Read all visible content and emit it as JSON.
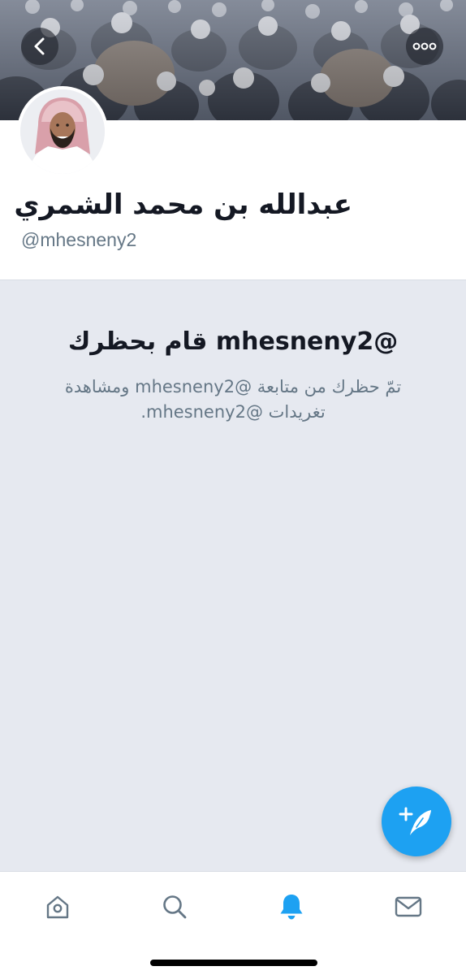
{
  "profile": {
    "display_name": "عبدالله بن محمد الشمري",
    "handle": "@mhesneny2"
  },
  "blocked_notice": {
    "title": "@mhesneny2 قام بحظرك",
    "body": "تمّ حظرك من متابعة @mhesneny2 ومشاهدة تغريدات @mhesneny2."
  },
  "icons": {
    "back": "chevron-left-icon",
    "more": "more-dots-icon",
    "compose": "compose-tweet-icon",
    "home": "home-icon",
    "search": "search-icon",
    "notifications": "bell-icon",
    "messages": "mail-icon"
  },
  "colors": {
    "accent": "#1da1f2",
    "background": "#e6e9f0",
    "text_primary": "#141823",
    "text_secondary": "#657786",
    "tab_inactive": "#657786"
  },
  "tabs": {
    "active": "notifications"
  }
}
